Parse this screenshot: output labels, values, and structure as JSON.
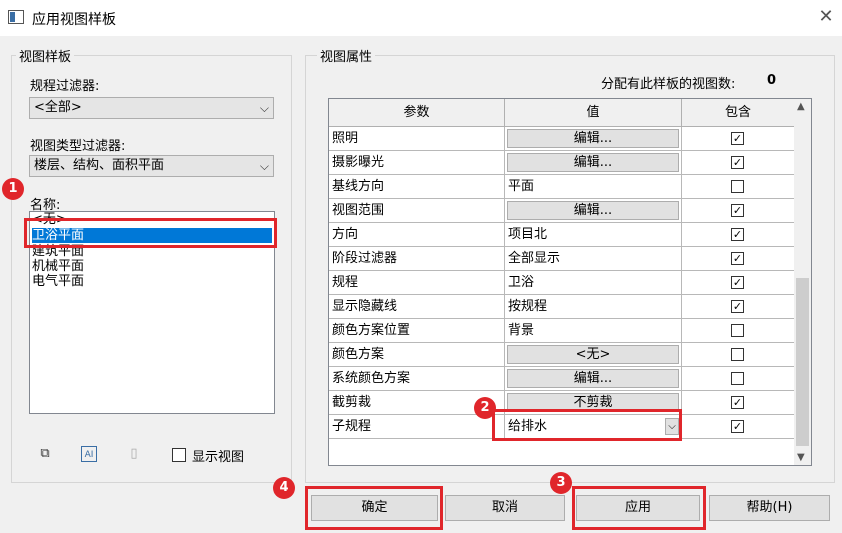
{
  "window": {
    "title": "应用视图样板",
    "close_glyph": "✕"
  },
  "left_panel": {
    "group_label": "视图样板",
    "discipline_filter_label": "规程过滤器:",
    "discipline_filter_value": "<全部>",
    "view_type_filter_label": "视图类型过滤器:",
    "view_type_filter_value": "楼层、结构、面积平面",
    "names_label": "名称:",
    "names": [
      "<无>",
      "卫浴平面",
      "建筑平面",
      "机械平面",
      "电气平面"
    ],
    "selected_index": 1,
    "show_views_label": "显示视图"
  },
  "right_panel": {
    "group_label": "视图属性",
    "assigned_count_label": "分配有此样板的视图数:",
    "assigned_count": "0",
    "columns": [
      "参数",
      "值",
      "包含"
    ],
    "rows": [
      {
        "param": "照明",
        "value": "编辑...",
        "type": "button",
        "include": true
      },
      {
        "param": "摄影曝光",
        "value": "编辑...",
        "type": "button",
        "include": true
      },
      {
        "param": "基线方向",
        "value": "平面",
        "type": "text",
        "include": false
      },
      {
        "param": "视图范围",
        "value": "编辑...",
        "type": "button",
        "include": true
      },
      {
        "param": "方向",
        "value": "项目北",
        "type": "text",
        "include": true
      },
      {
        "param": "阶段过滤器",
        "value": "全部显示",
        "type": "text",
        "include": true
      },
      {
        "param": "规程",
        "value": "卫浴",
        "type": "text",
        "include": true
      },
      {
        "param": "显示隐藏线",
        "value": "按规程",
        "type": "text",
        "include": true
      },
      {
        "param": "颜色方案位置",
        "value": "背景",
        "type": "text",
        "include": false
      },
      {
        "param": "颜色方案",
        "value": "<无>",
        "type": "button",
        "include": false
      },
      {
        "param": "系统颜色方案",
        "value": "编辑...",
        "type": "button",
        "include": false
      },
      {
        "param": "截剪裁",
        "value": "不剪裁",
        "type": "button",
        "include": true
      },
      {
        "param": "子规程",
        "value": "给排水",
        "type": "dropdown",
        "include": true
      }
    ]
  },
  "buttons": {
    "ok": "确定",
    "cancel": "取消",
    "apply": "应用",
    "help": "帮助(H)"
  },
  "annotations": [
    "1",
    "2",
    "3",
    "4"
  ],
  "check_glyph": "✓",
  "colors": {
    "highlight": "#0078d7",
    "annotation_red": "#e0262b"
  }
}
